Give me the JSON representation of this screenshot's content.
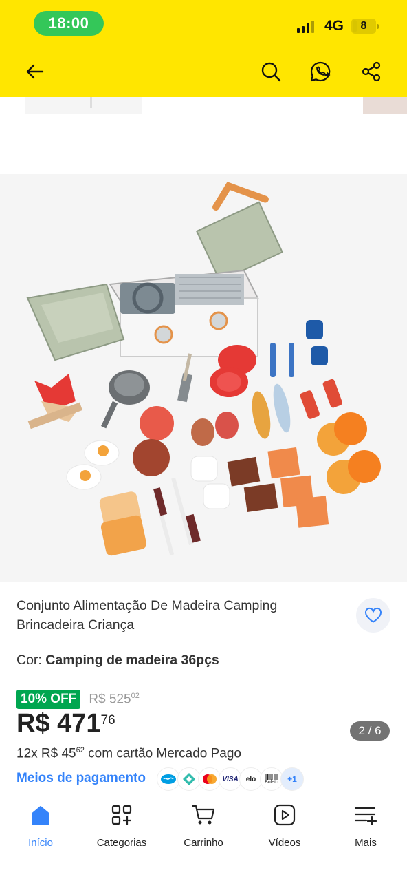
{
  "status_bar": {
    "time": "18:00",
    "network": "4G",
    "battery": "8",
    "battery_fill": 0.18
  },
  "header": {
    "icons": [
      "back-arrow-icon",
      "search-icon",
      "whatsapp-share-icon",
      "share-icon"
    ]
  },
  "gallery": {
    "counter": "2 / 6"
  },
  "product": {
    "title": "Conjunto Alimentação De Madeira Camping Brincadeira Criança",
    "color_label": "Cor:",
    "color_value": "Camping de madeira 36pçs",
    "discount_badge": "10% OFF",
    "old_price_main": "R$ 525",
    "old_price_cents": "02",
    "price_main": "R$ 471",
    "price_cents": "76",
    "installments_prefix": "12x R$ 45",
    "installments_cents": "62",
    "installments_suffix": " com cartão Mercado Pago",
    "payment_link": "Meios de pagamento",
    "payment_icons": [
      "mercado-pago-icon",
      "pix-icon",
      "mastercard-icon",
      "VISA",
      "elo",
      "Boleto"
    ],
    "payment_more": "+1"
  },
  "bottom_nav": [
    {
      "label": "Início",
      "icon": "home-icon"
    },
    {
      "label": "Categorias",
      "icon": "categories-icon"
    },
    {
      "label": "Carrinho",
      "icon": "cart-icon"
    },
    {
      "label": "Vídeos",
      "icon": "video-icon"
    },
    {
      "label": "Mais",
      "icon": "more-menu-icon"
    }
  ],
  "colors": {
    "brand_yellow": "#FFE600",
    "link_blue": "#3483FA",
    "discount_green": "#00A650"
  }
}
